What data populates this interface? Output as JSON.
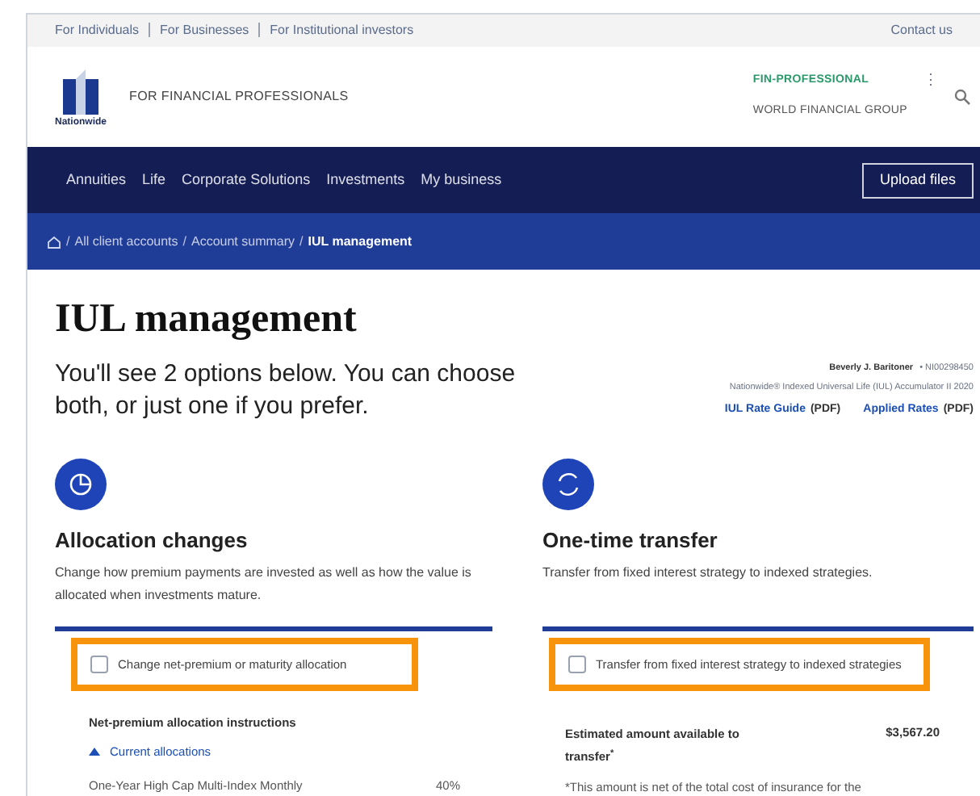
{
  "top_links": [
    "For Individuals",
    "For Businesses",
    "For Institutional investors"
  ],
  "contact_link": "Contact us",
  "header": {
    "logo_text": "Nationwide",
    "tagline": "FOR FINANCIAL PROFESSIONALS",
    "user_role": "FIN-PROFESSIONAL",
    "user_org": "WORLD FINANCIAL GROUP",
    "menu_dots": "⋮"
  },
  "nav": {
    "items": [
      "Annuities",
      "Life",
      "Corporate Solutions",
      "Investments",
      "My business"
    ],
    "button": "Upload files"
  },
  "breadcrumb": [
    {
      "separator": "/",
      "label": "All client accounts",
      "current": false
    },
    {
      "separator": "/",
      "label": "Account summary",
      "current": false
    },
    {
      "separator": "/",
      "label": "IUL management",
      "current": true
    }
  ],
  "page": {
    "title": "IUL management",
    "intro": "You'll see 2 options below. You can choose both, or just one if you prefer."
  },
  "account": {
    "name": "Beverly J. Baritoner",
    "number": "• NI00298450",
    "product": "Nationwide® Indexed Universal Life (IUL) Accumulator II 2020",
    "links": [
      {
        "label": "IUL Rate Guide",
        "suffix": "(PDF)"
      },
      {
        "label": "Applied Rates",
        "suffix": "(PDF)"
      }
    ]
  },
  "options": [
    {
      "kind": "pie",
      "title": "Allocation changes",
      "description": "Change how premium payments are invested as well as how the value is allocated when investments mature.",
      "checkbox": {
        "label": "Change net-premium or maturity allocation",
        "checked": false,
        "highlighted": true
      }
    },
    {
      "kind": "cycle",
      "title": "One-time transfer",
      "description": "Transfer from fixed interest strategy to indexed strategies.",
      "checkbox": {
        "label": "Transfer from fixed interest strategy to indexed strategies",
        "checked": false,
        "highlighted": true
      }
    }
  ],
  "allocation_details": {
    "heading": "Net-premium allocation instructions",
    "toggle": "Current allocations",
    "expanded": true,
    "rows": [
      {
        "name": "One-Year High Cap Multi-Index Monthly",
        "percent": "40%"
      }
    ]
  },
  "transfer_details": {
    "label": "Estimated amount available to transfer",
    "footnote_mark": "*",
    "amount": "$3,567.20",
    "note": "*This amount is net of the total cost of insurance for the"
  }
}
